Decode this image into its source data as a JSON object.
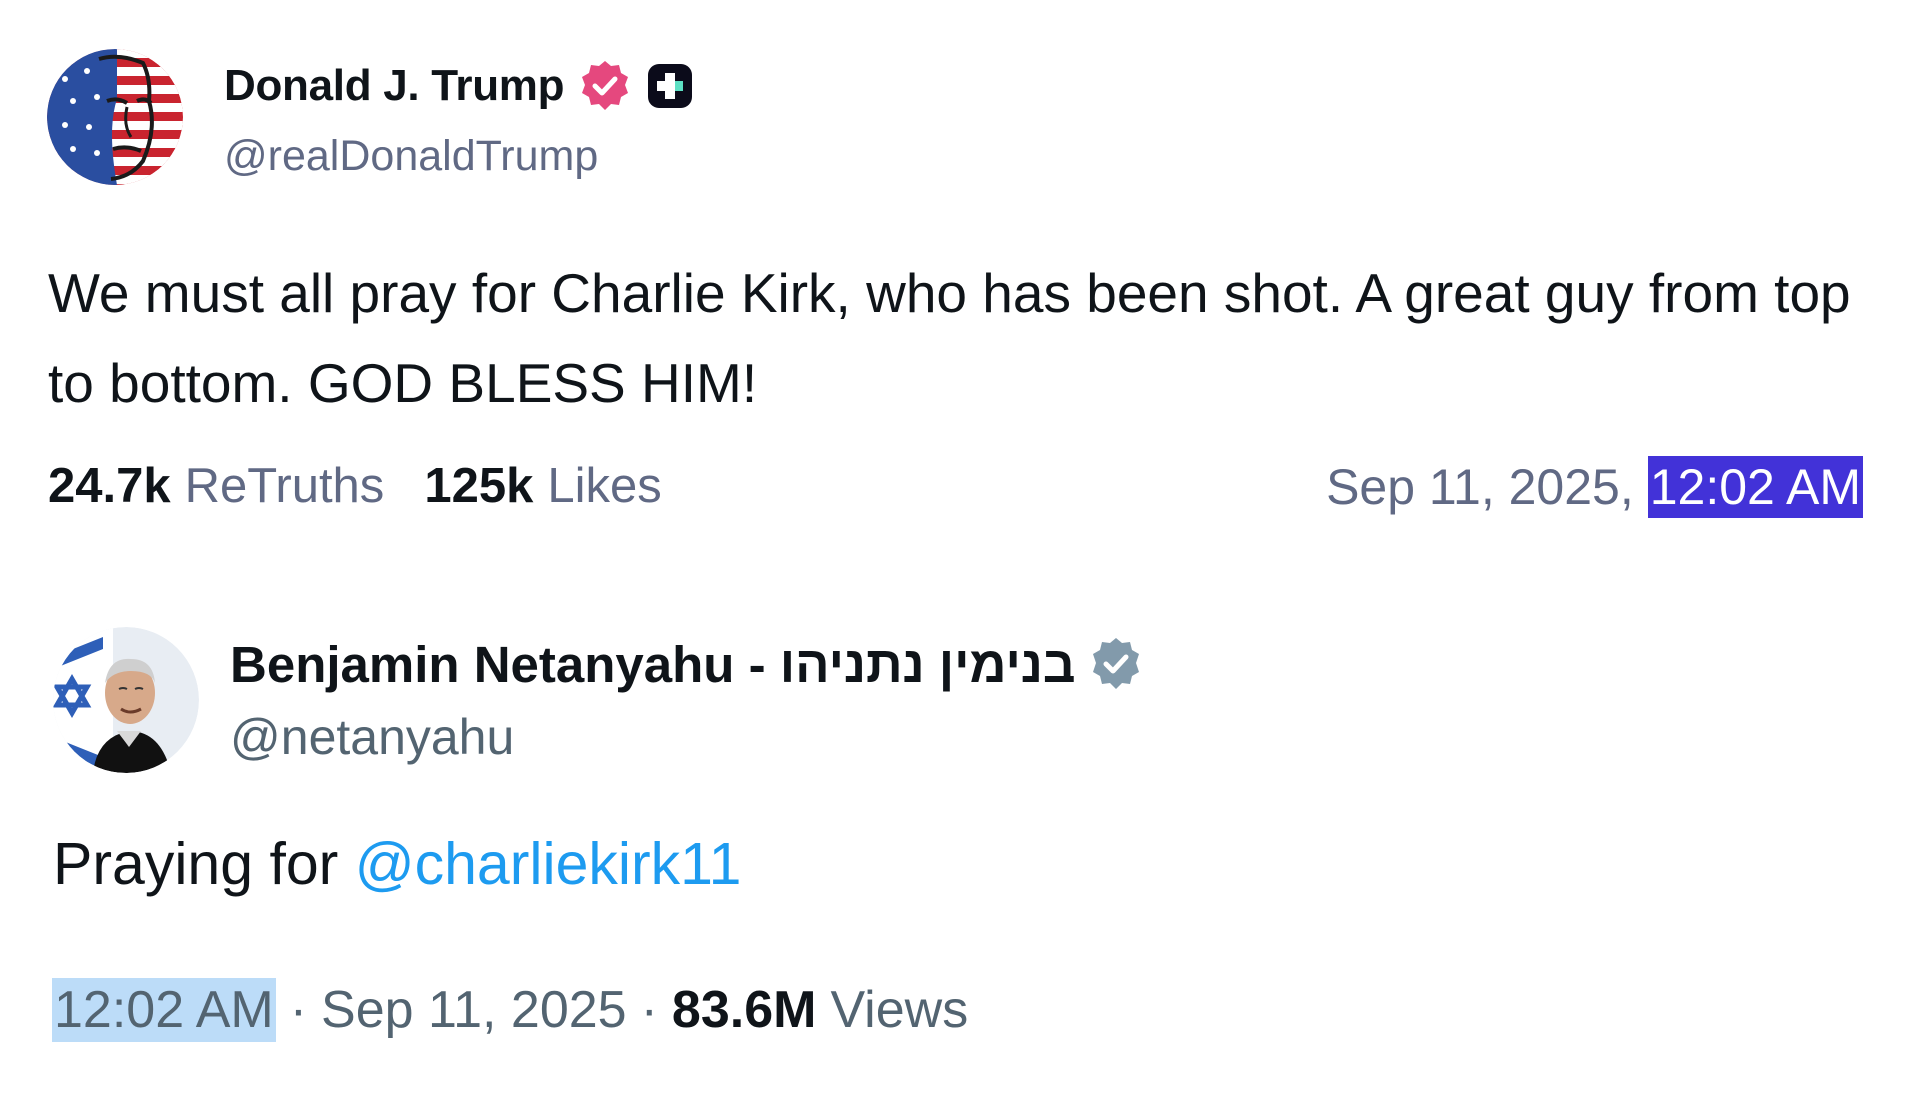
{
  "posts": [
    {
      "avatar": "flag-face-avatar",
      "display_name": "Donald J. Trump",
      "verified_badge": "pink-verified-icon",
      "platform_badge": "truth-social-plus-icon",
      "handle": "@realDonaldTrump",
      "text": "We must all pray for Charlie Kirk, who has been shot. A great guy from top to bottom. GOD BLESS HIM!",
      "stats": {
        "retruths_count": "24.7k",
        "retruths_label": "ReTruths",
        "likes_count": "125k",
        "likes_label": "Likes"
      },
      "date": "Sep 11, 2025,",
      "time": "12:02 AM",
      "colors": {
        "badge": "#e5487e",
        "time_highlight": "#4232d8"
      }
    },
    {
      "avatar": "portrait-avatar",
      "display_name": "Benjamin Netanyahu - בנימין נתניהו",
      "verified_badge": "gray-verified-icon",
      "handle": "@netanyahu",
      "text_prefix": "Praying for",
      "mention": "@charliekirk11",
      "time": "12:02 AM",
      "separator": "·",
      "date": "Sep 11, 2025",
      "views_count": "83.6M",
      "views_label": "Views",
      "colors": {
        "mention": "#1d9bf0",
        "badge": "#829aab",
        "time_highlight": "#bcdcf8"
      }
    }
  ]
}
